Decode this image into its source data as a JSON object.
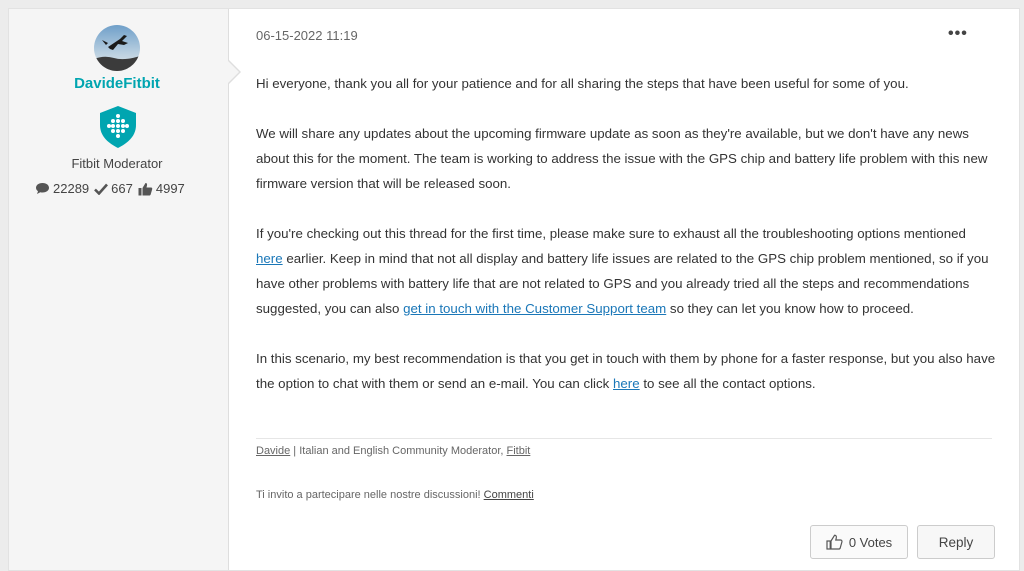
{
  "author": {
    "username": "DavideFitbit",
    "rank": "Fitbit Moderator",
    "stats": {
      "posts": "22289",
      "solutions": "667",
      "kudos": "4997"
    }
  },
  "post": {
    "date": "06-15-2022 11:19",
    "menu": "•••",
    "p1": "Hi everyone, thank you all for your patience and for all sharing the steps that have been useful for some of you.",
    "p2": "We will share any updates about the upcoming firmware update as soon as they're available, but we don't have any news about this for the moment. The team is working to address the issue with the GPS chip and battery life problem with this new firmware version that will be released soon.",
    "p3_a": "If you're checking out this thread for the first time, please make sure to exhaust all the troubleshooting options mentioned ",
    "p3_link1": "here",
    "p3_b": " earlier. Keep in mind that not all display and battery life issues are related to the GPS chip problem mentioned, so if you have other problems with battery life that are not related to GPS and you already tried all the steps and recommendations suggested, you can also ",
    "p3_link2": "get in touch with the Customer Support team",
    "p3_c": " so they can let you know how to proceed.",
    "p4_a": "In this scenario, my best recommendation is that you get in touch with them by phone for a faster response, but you also have the option to chat with them or send an e-mail. You can click ",
    "p4_link": "here",
    "p4_b": " to see all the contact options."
  },
  "signature": {
    "name_link": "Davide",
    "middle": " | Italian and English Community Moderator, ",
    "company_link": "Fitbit",
    "invite_text": "Ti invito a partecipare nelle nostre discussioni! ",
    "invite_link": "Commenti"
  },
  "actions": {
    "votes_label": "0 Votes",
    "reply_label": "Reply"
  },
  "colors": {
    "accent": "#00a5b0",
    "link": "#1a77b8"
  }
}
